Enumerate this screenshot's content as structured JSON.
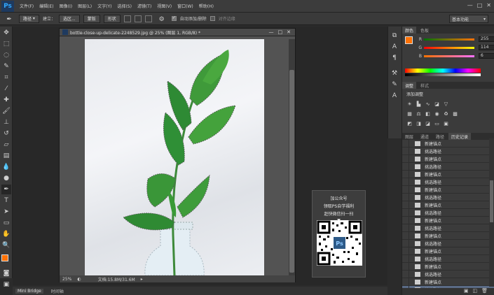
{
  "app": {
    "logo": "Ps",
    "menus": [
      "文件(F)",
      "编辑(E)",
      "图像(I)",
      "图层(L)",
      "文字(Y)",
      "选择(S)",
      "滤镜(T)",
      "视图(V)",
      "窗口(W)",
      "帮助(H)"
    ],
    "window_controls": [
      "—",
      "□",
      "✕"
    ]
  },
  "options_bar": {
    "mode_value": "路径",
    "build_label": "建立：",
    "selection_button": "选区...",
    "mask_button": "蒙版",
    "shape_button": "形状",
    "auto_add_delete_label": "自动添加/删除",
    "auto_add_delete_checked": true,
    "align_edges_label": "对齐边缘",
    "align_edges_checked": false,
    "workspace": "基本功能"
  },
  "document": {
    "title": "bottle-close-up-delicate-2248529.jpg @ 25% (图层 1, RGB/8) *",
    "zoom": "25%",
    "doc_size": "文档:15.8M/31.6M"
  },
  "promo": {
    "line1": "加公众号",
    "line2": "领取PS自学福利",
    "line3": "赶快微信扫一扫",
    "arrow": "▼",
    "qr_badge": "Ps"
  },
  "bottom_tabs": [
    "Mini Bridge",
    "时间轴"
  ],
  "color_panel": {
    "tabs": [
      "颜色",
      "色板"
    ],
    "r_label": "R",
    "g_label": "G",
    "b_label": "B",
    "r": "255",
    "g": "114",
    "b": "6",
    "foreground": "#ff7206"
  },
  "adjust_panel": {
    "tabs": [
      "调整",
      "样式"
    ],
    "heading": "添加调整"
  },
  "history_panel": {
    "tabs": [
      "图层",
      "通道",
      "路径",
      "历史记录"
    ],
    "items": [
      "新建锚点",
      "挑选路径",
      "新建锚点",
      "挑选路径",
      "新建锚点",
      "挑选路径",
      "新建锚点",
      "挑选路径",
      "新建锚点",
      "挑选路径",
      "新建锚点",
      "挑选路径",
      "新建锚点",
      "挑选路径",
      "新建锚点",
      "挑选路径",
      "新建锚点",
      "挑选路径",
      "新建锚点",
      "挑选路径"
    ],
    "selected_index": 19
  }
}
